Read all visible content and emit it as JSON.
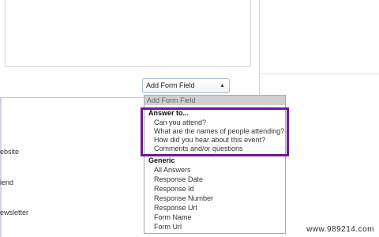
{
  "form": {
    "select": {
      "value": "Add Form Field",
      "arrow_icon": "up-down-arrows-icon"
    },
    "dropdown": {
      "selected_option": "Add Form Field",
      "groups": [
        {
          "label": "Answer to...",
          "items": [
            "Can you attend?",
            "What are the names of people attending?",
            "How did you hear about this event?",
            "Comments and/or questions"
          ]
        },
        {
          "label": "Generic",
          "items": [
            "All Answers",
            "Response Date",
            "Response Id",
            "Response Number",
            "Response Url",
            "Form Name",
            "Form Url"
          ]
        }
      ],
      "highlight_color": "#6a1b9a"
    }
  },
  "left_labels": [
    "ebsite",
    "iend",
    "ewsletter"
  ],
  "watermark": "www.989214.com"
}
